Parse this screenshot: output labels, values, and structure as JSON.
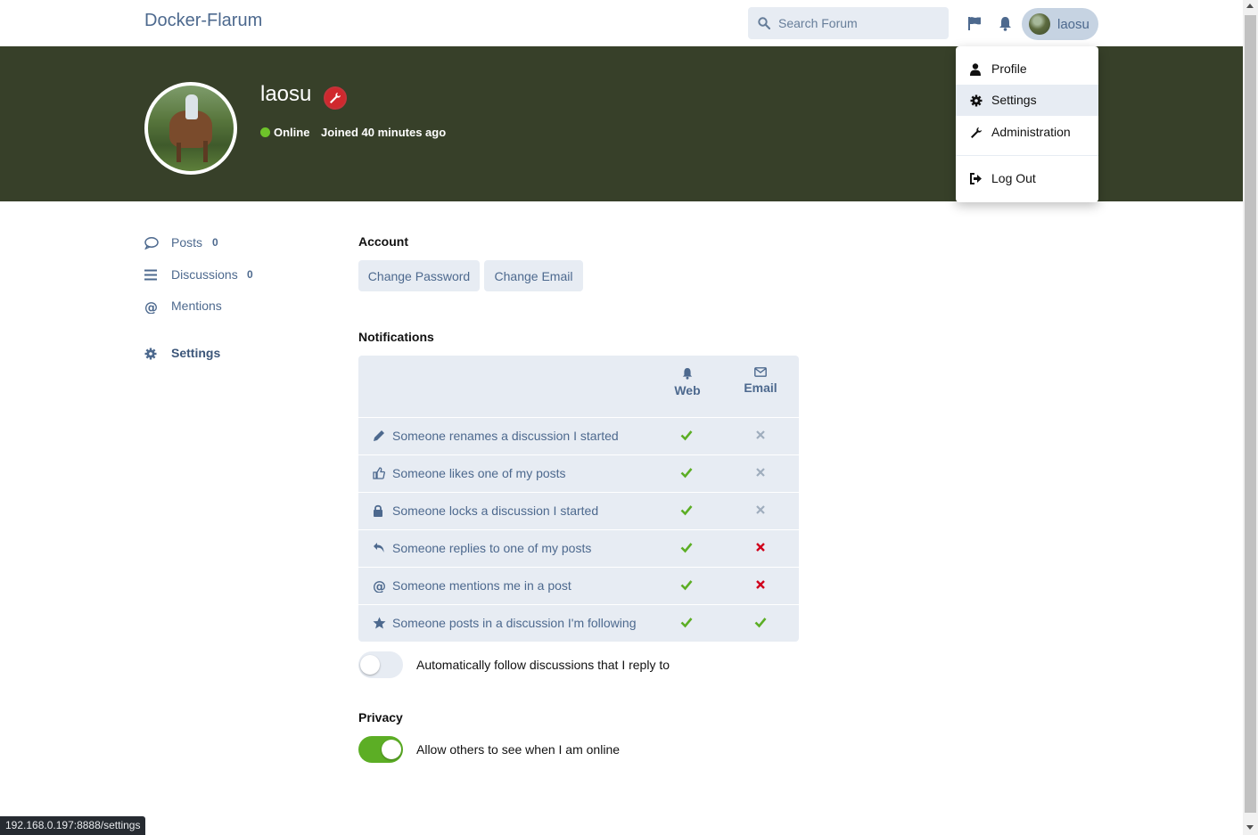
{
  "header": {
    "brand": "Docker-Flarum",
    "search_placeholder": "Search Forum",
    "username": "laosu"
  },
  "hero": {
    "username": "laosu",
    "status": "Online",
    "joined": "Joined 40 minutes ago"
  },
  "dropdown": {
    "items": [
      {
        "label": "Profile",
        "icon": "user-icon"
      },
      {
        "label": "Settings",
        "icon": "gear-icon"
      },
      {
        "label": "Administration",
        "icon": "wrench-icon"
      },
      {
        "label": "Log Out",
        "icon": "sign-out-icon"
      }
    ]
  },
  "sidebar": {
    "items": [
      {
        "label": "Posts",
        "count": "0",
        "icon": "comment-icon"
      },
      {
        "label": "Discussions",
        "count": "0",
        "icon": "bars-icon"
      },
      {
        "label": "Mentions",
        "count": "",
        "icon": "at-icon"
      },
      {
        "label": "Settings",
        "count": "",
        "icon": "gear-icon"
      }
    ]
  },
  "account": {
    "heading": "Account",
    "change_password": "Change Password",
    "change_email": "Change Email"
  },
  "notifications": {
    "heading": "Notifications",
    "col_web": "Web",
    "col_email": "Email",
    "rows": [
      {
        "label": "Someone renames a discussion I started",
        "icon": "pencil-icon",
        "web": true,
        "email": "off"
      },
      {
        "label": "Someone likes one of my posts",
        "icon": "thumbs-up-icon",
        "web": true,
        "email": "off"
      },
      {
        "label": "Someone locks a discussion I started",
        "icon": "lock-icon",
        "web": true,
        "email": "off"
      },
      {
        "label": "Someone replies to one of my posts",
        "icon": "reply-icon",
        "web": true,
        "email": "disabled"
      },
      {
        "label": "Someone mentions me in a post",
        "icon": "at-icon",
        "web": true,
        "email": "disabled"
      },
      {
        "label": "Someone posts in a discussion I'm following",
        "icon": "star-icon",
        "web": true,
        "email": "on"
      }
    ],
    "auto_follow_label": "Automatically follow discussions that I reply to",
    "auto_follow_on": false
  },
  "privacy": {
    "heading": "Privacy",
    "online_label": "Allow others to see when I am online",
    "online_on": true
  },
  "status_url": "192.168.0.197:8888/settings",
  "colors": {
    "primary": "#4d698e",
    "hero_bg": "#374029",
    "check_green": "#5cae25",
    "cross_red": "#d0011b",
    "control_bg": "#e7ecf3"
  }
}
